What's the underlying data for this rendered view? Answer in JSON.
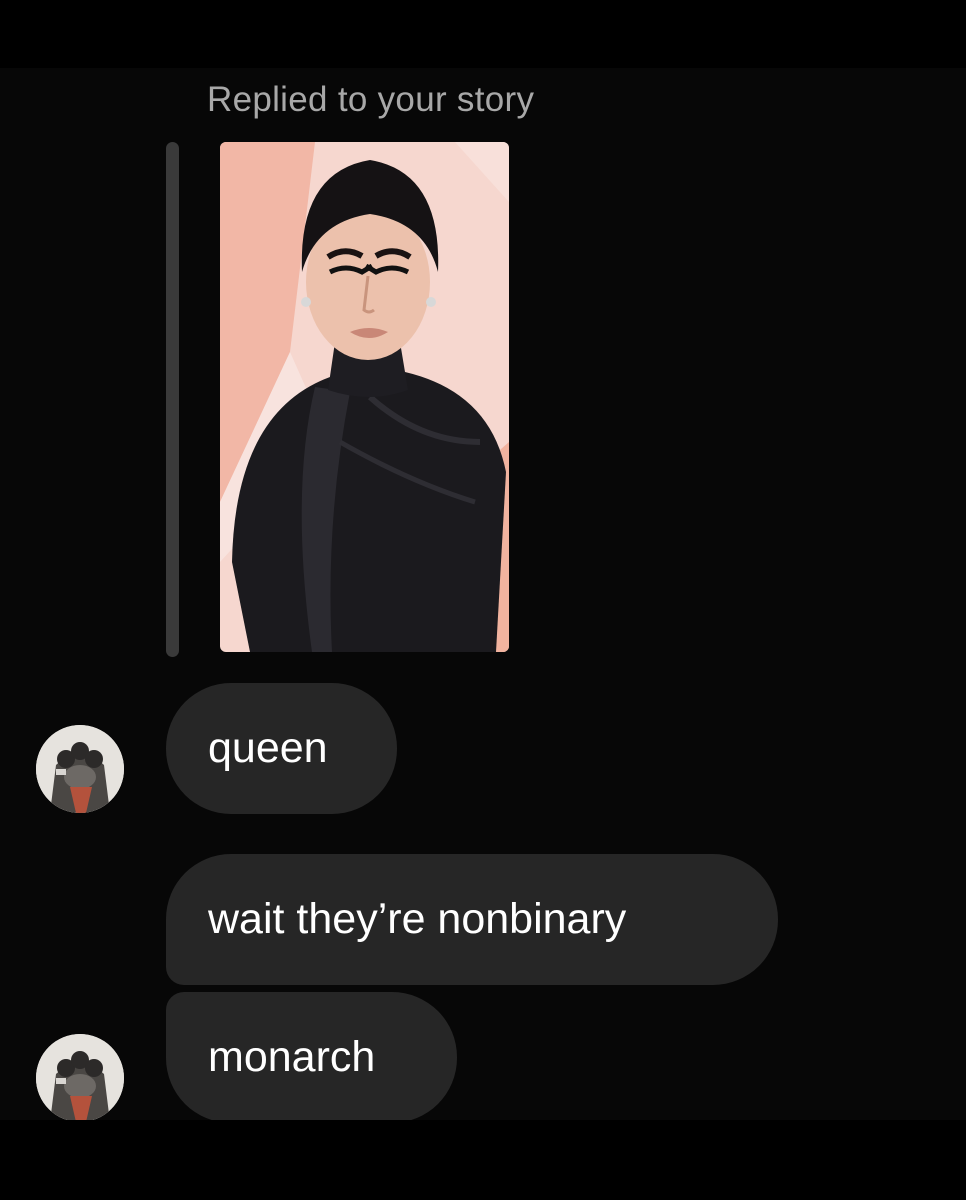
{
  "reply": {
    "label": "Replied to your story",
    "story_image": "story-photo-person-in-black-turtleneck"
  },
  "messages": [
    {
      "text": "queen",
      "has_avatar": true
    },
    {
      "text": "wait they’re nonbinary",
      "has_avatar": false
    },
    {
      "text": "monarch",
      "has_avatar": true
    }
  ],
  "colors": {
    "background": "#000000",
    "bubble": "#262626",
    "bubble_text": "#ffffff",
    "reply_label": "#a8a8a8",
    "reply_bar": "#3a3a3a",
    "story_background": "#f6d7cf"
  },
  "avatar": {
    "icon": "animal-paw-avatar"
  }
}
